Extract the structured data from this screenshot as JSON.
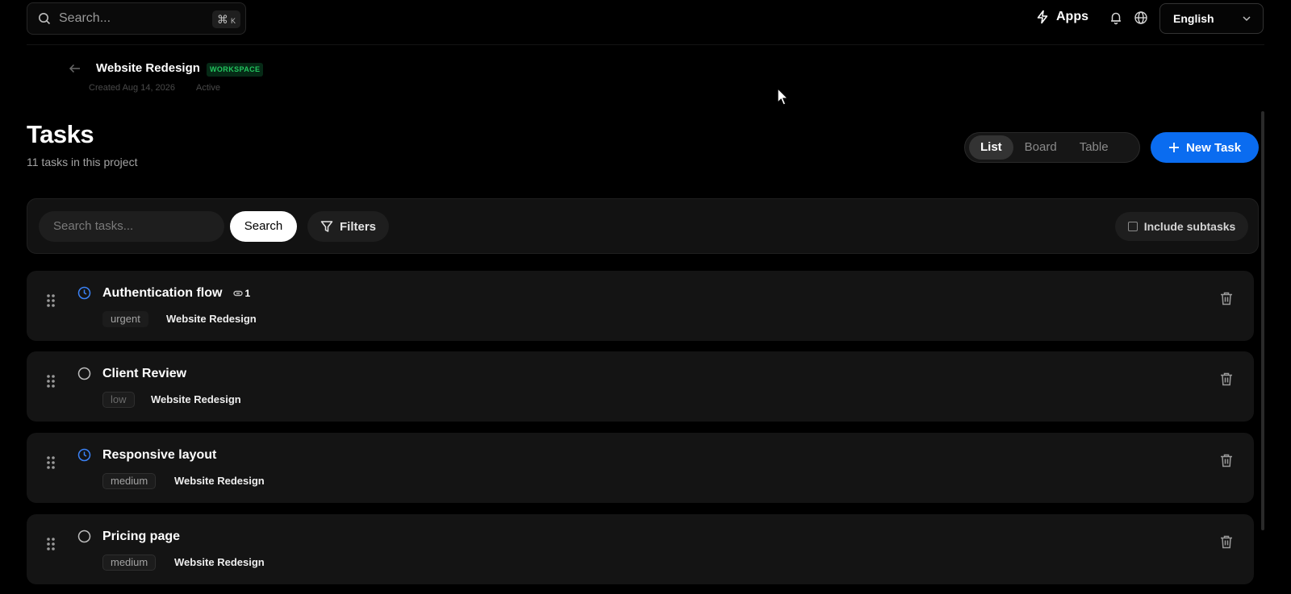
{
  "topbar": {
    "search_placeholder": "Search...",
    "shortcut_symbol": "⌘",
    "shortcut_key": "K",
    "apps_label": "Apps",
    "language": "English"
  },
  "project": {
    "name": "Website Redesign",
    "badge": "WORKSPACE",
    "created": "Created Aug 14, 2026",
    "status": "Active"
  },
  "page": {
    "title": "Tasks",
    "subtitle": "11 tasks in this project"
  },
  "views": {
    "list": "List",
    "board": "Board",
    "table": "Table",
    "active": "List"
  },
  "new_task_label": "New Task",
  "filters": {
    "search_placeholder": "Search tasks...",
    "search_button": "Search",
    "filters_button": "Filters",
    "include_subtasks": "Include subtasks",
    "include_subtasks_checked": false
  },
  "tasks": [
    {
      "title": "Authentication flow",
      "status": "in-progress",
      "attachments": "1",
      "priority": "urgent",
      "project": "Website Redesign"
    },
    {
      "title": "Client Review",
      "status": "todo",
      "priority": "low",
      "project": "Website Redesign"
    },
    {
      "title": "Responsive layout",
      "status": "in-progress",
      "priority": "medium",
      "project": "Website Redesign"
    },
    {
      "title": "Pricing page",
      "status": "todo",
      "priority": "medium",
      "project": "Website Redesign"
    }
  ],
  "colors": {
    "accent": "#0a6cf0",
    "badge_green": "#22c55e",
    "progress_icon": "#3b82f6"
  }
}
